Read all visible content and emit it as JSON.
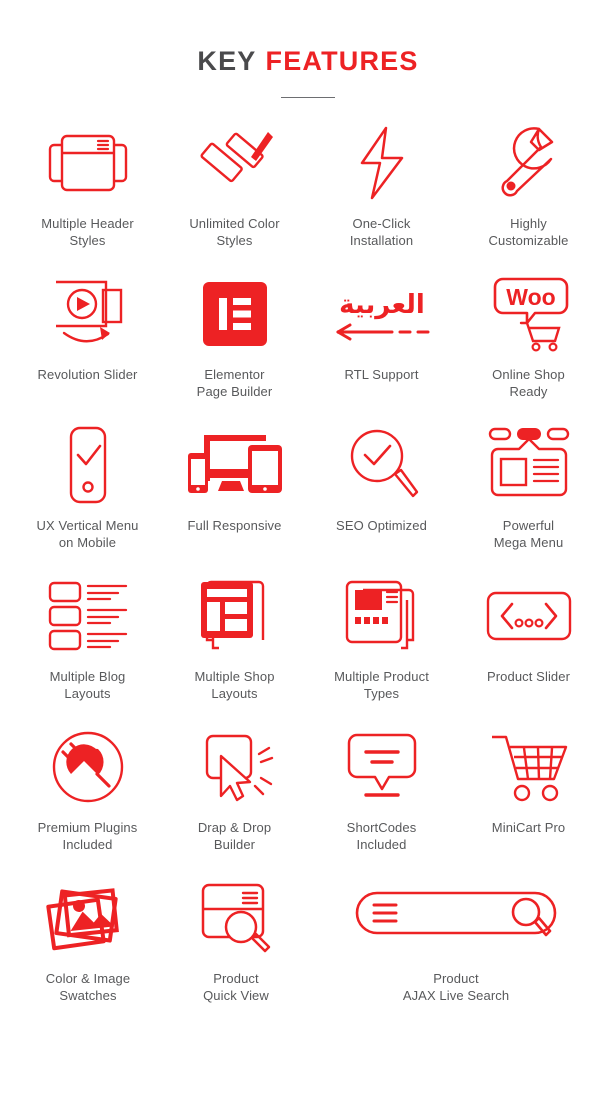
{
  "heading": {
    "part1": "KEY",
    "part2": "FEATURES",
    "accent_color": "#ED2224",
    "text_color": "#4a4a4c"
  },
  "colors": {
    "red": "#ED2224",
    "label_gray": "#58595B",
    "background": "#FFFFFF"
  },
  "features": [
    [
      {
        "icon": "multiple-header-styles-icon",
        "label": "Multiple Header\nStyles"
      },
      {
        "icon": "paint-roller-icon",
        "label": "Unlimited Color\nStyles"
      },
      {
        "icon": "lightning-bolt-icon",
        "label": "One-Click\nInstallation"
      },
      {
        "icon": "wrench-icon",
        "label": "Highly\nCustomizable"
      }
    ],
    [
      {
        "icon": "revolution-slider-icon",
        "label": "Revolution Slider"
      },
      {
        "icon": "elementor-logo-icon",
        "label": "Elementor\nPage Builder"
      },
      {
        "icon": "rtl-arrow-icon",
        "label": "RTL Support",
        "arabic": "العربية"
      },
      {
        "icon": "woocommerce-cart-icon",
        "label": "Online Shop\nReady",
        "woo_text": "Woo"
      }
    ],
    [
      {
        "icon": "mobile-checkmark-icon",
        "label": "UX Vertical Menu\non Mobile"
      },
      {
        "icon": "responsive-devices-icon",
        "label": "Full Responsive"
      },
      {
        "icon": "magnifier-check-icon",
        "label": "SEO Optimized"
      },
      {
        "icon": "mega-menu-icon",
        "label": "Powerful\nMega Menu"
      }
    ],
    [
      {
        "icon": "blog-list-icon",
        "label": "Multiple Blog\nLayouts"
      },
      {
        "icon": "shop-layout-pages-icon",
        "label": "Multiple Shop\nLayouts"
      },
      {
        "icon": "product-types-pages-icon",
        "label": "Multiple Product\nTypes"
      },
      {
        "icon": "product-slider-icon",
        "label": "Product Slider"
      }
    ],
    [
      {
        "icon": "plug-circle-icon",
        "label": "Premium Plugins\nIncluded"
      },
      {
        "icon": "drag-drop-cursor-icon",
        "label": "Drap & Drop\nBuilder"
      },
      {
        "icon": "shortcodes-bubble-icon",
        "label": "ShortCodes\nIncluded"
      },
      {
        "icon": "shopping-cart-icon",
        "label": "MiniCart Pro"
      }
    ],
    [
      {
        "icon": "photo-stack-icon",
        "label": "Color & Image\nSwatches"
      },
      {
        "icon": "quick-view-card-icon",
        "label": "Product\nQuick View"
      },
      {
        "icon": "ajax-search-bar-icon",
        "label": "Product\nAJAX Live Search"
      }
    ]
  ]
}
